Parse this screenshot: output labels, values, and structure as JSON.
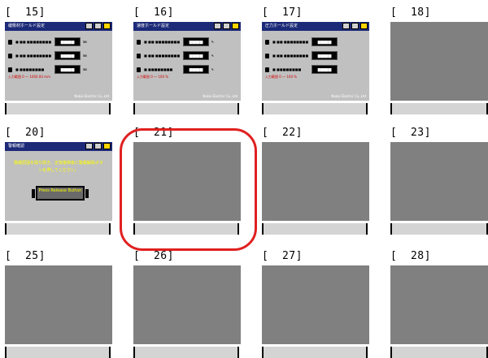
{
  "cells": [
    {
      "num": "[  15]",
      "name": "",
      "screen": {
        "title": "緩衝材ホールド設定",
        "rows": [
          {
            "label": "■ ■■ ■■■■■■■■",
            "value": "■■■■",
            "unit": "mm"
          },
          {
            "label": "■ ■■ ■■■■■■■■",
            "value": "■■■■",
            "unit": "mm"
          },
          {
            "label": "■ ■■■■■■■■",
            "value": "■■■■",
            "unit": "mm"
          }
        ],
        "note": "入力範囲 0 ～ 1000.00 mm",
        "maker": "Nakai Electric Co.,Ltd"
      }
    },
    {
      "num": "[  16]",
      "name": "",
      "screen": {
        "title": "速度ホールド設定",
        "rows": [
          {
            "label": "■ ■■ ■■■■■■■■",
            "value": "■■■■",
            "unit": "%"
          },
          {
            "label": "■ ■■ ■■■■■■■■",
            "value": "■■■■",
            "unit": "%"
          },
          {
            "label": "■ ■■■■■■■■",
            "value": "■■■■",
            "unit": "%"
          }
        ],
        "note": "入力範囲 0 ～ 100 %",
        "maker": "Nakai Electric Co.,Ltd"
      }
    },
    {
      "num": "[  17]",
      "name": "",
      "screen": {
        "title": "圧力ホールド設定",
        "rows": [
          {
            "label": "■ ■■ ■■■■■■■■",
            "value": "■■■■",
            "unit": ""
          },
          {
            "label": "■ ■■ ■■■■■■■■",
            "value": "■■■■",
            "unit": ""
          },
          {
            "label": "■ ■■■■■■■■",
            "value": "■■■■",
            "unit": ""
          }
        ],
        "note": "入力範囲 0 ～ 100 %",
        "maker": "Nakai Electric Co.,Ltd"
      }
    },
    {
      "num": "[  18]",
      "name": ""
    },
    {
      "num": "[  20]",
      "name": "",
      "screen": {
        "title": "警報確認",
        "message": "警報原因を取り除き、正常復帰後に警報解除ボタンを押してください。",
        "button": "Press Release Button"
      }
    },
    {
      "num": "[  21]",
      "name": ""
    },
    {
      "num": "[  22]",
      "name": ""
    },
    {
      "num": "[  23]",
      "name": ""
    },
    {
      "num": "[  25]",
      "name": ""
    },
    {
      "num": "[  26]",
      "name": ""
    },
    {
      "num": "[  27]",
      "name": ""
    },
    {
      "num": "[  28]",
      "name": ""
    }
  ],
  "selection": {
    "num": "[  21]",
    "color": "#e02020"
  },
  "colors": {
    "empty_thumb": "#808080",
    "screen_bg": "#c0c0c0",
    "title_bar": "#1c2a78",
    "warn_text": "#ffff00"
  }
}
